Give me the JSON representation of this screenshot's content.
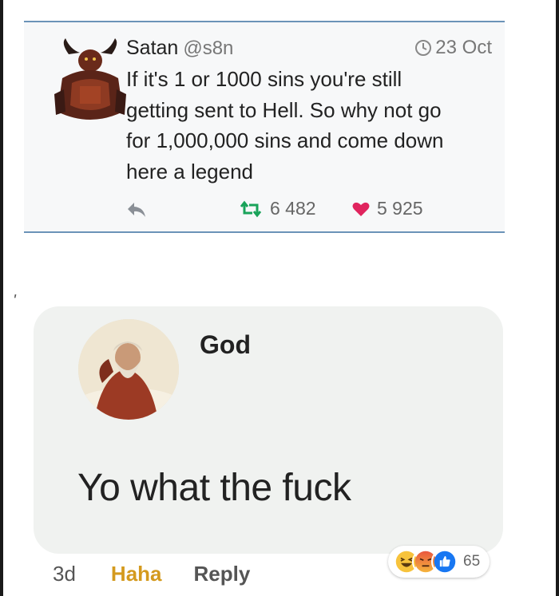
{
  "tweet": {
    "name": "Satan",
    "handle": "@s8n",
    "timestamp": "23 Oct",
    "body_lines": [
      "If it's 1 or 1000 sins you're still",
      "getting sent to Hell. So why not go",
      "for 1,000,000 sins and come down",
      "here a legend"
    ],
    "retweets": "6 482",
    "likes": "5 925",
    "icons": [
      "devil-avatar",
      "clock-icon",
      "reply-icon",
      "retweet-icon",
      "heart-icon"
    ]
  },
  "stray_mark": "'",
  "comment": {
    "author": "God",
    "text": "Yo what the fuck",
    "time": "3d",
    "haha_label": "Haha",
    "reply_label": "Reply",
    "reaction_count": "65",
    "reactions": [
      "haha-emoji",
      "angry-emoji",
      "like-emoji"
    ]
  },
  "colors": {
    "tweet_border": "#6b93b8",
    "retweet_green": "#19a35a",
    "heart_red": "#e0245e",
    "haha_yellow": "#d49a1e",
    "like_blue": "#1877f2"
  }
}
